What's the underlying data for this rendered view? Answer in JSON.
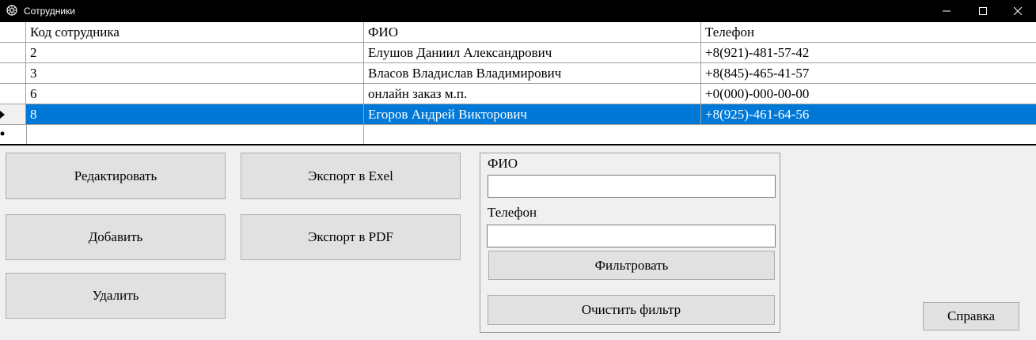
{
  "window": {
    "title": "Сотрудники"
  },
  "table": {
    "columns": [
      "Код сотрудника",
      "ФИО",
      "Телефон"
    ],
    "rows": [
      {
        "id": "2",
        "fio": "Елушов Даниил Александрович",
        "phone": "+8(921)-481-57-42"
      },
      {
        "id": "3",
        "fio": "Власов Владислав Владимирович",
        "phone": "+8(845)-465-41-57"
      },
      {
        "id": "6",
        "fio": "онлайн заказ м.п.",
        "phone": "+0(000)-000-00-00"
      },
      {
        "id": "8",
        "fio": "Егоров Андрей Викторович",
        "phone": "+8(925)-461-64-56"
      }
    ],
    "selected_row_index": 3
  },
  "buttons": {
    "edit": "Редактировать",
    "add": "Добавить",
    "delete": "Удалить",
    "export_exel": "Экспорт в Exel",
    "export_pdf": "Экспорт в PDF",
    "help": "Справка"
  },
  "filter": {
    "fio_label": "ФИО",
    "fio_value": "",
    "phone_label": "Телефон",
    "phone_value": "",
    "apply_button": "Фильтровать",
    "clear_button": "Очистить фильтр"
  },
  "colors": {
    "selection": "#0078d7",
    "titlebar": "#000000",
    "window_bg": "#f0f0f0",
    "button_bg": "#e1e1e1"
  }
}
